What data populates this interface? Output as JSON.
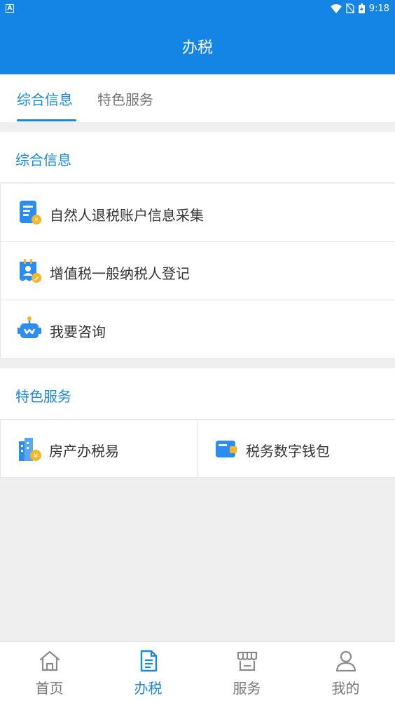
{
  "status_bar": {
    "time": "9:18"
  },
  "app_bar": {
    "title": "办税"
  },
  "tabs": [
    {
      "label": "综合信息",
      "active": true
    },
    {
      "label": "特色服务",
      "active": false
    }
  ],
  "sections": {
    "general": {
      "title": "综合信息",
      "items": [
        {
          "label": "自然人退税账户信息采集",
          "icon": "tax-refund-form-icon"
        },
        {
          "label": "增值税一般纳税人登记",
          "icon": "taxpayer-register-icon"
        },
        {
          "label": "我要咨询",
          "icon": "robot-consult-icon"
        }
      ]
    },
    "featured": {
      "title": "特色服务",
      "items": [
        {
          "label": "房产办税易",
          "icon": "property-tax-icon"
        },
        {
          "label": "税务数字钱包",
          "icon": "digital-wallet-icon"
        }
      ]
    }
  },
  "bottom_nav": [
    {
      "label": "首页",
      "icon": "home-icon",
      "active": false
    },
    {
      "label": "办税",
      "icon": "document-icon",
      "active": true
    },
    {
      "label": "服务",
      "icon": "store-icon",
      "active": false
    },
    {
      "label": "我的",
      "icon": "user-icon",
      "active": false
    }
  ],
  "colors": {
    "primary": "#1585e5",
    "accent": "#1b89d8",
    "icon_orange": "#f5b62a"
  }
}
